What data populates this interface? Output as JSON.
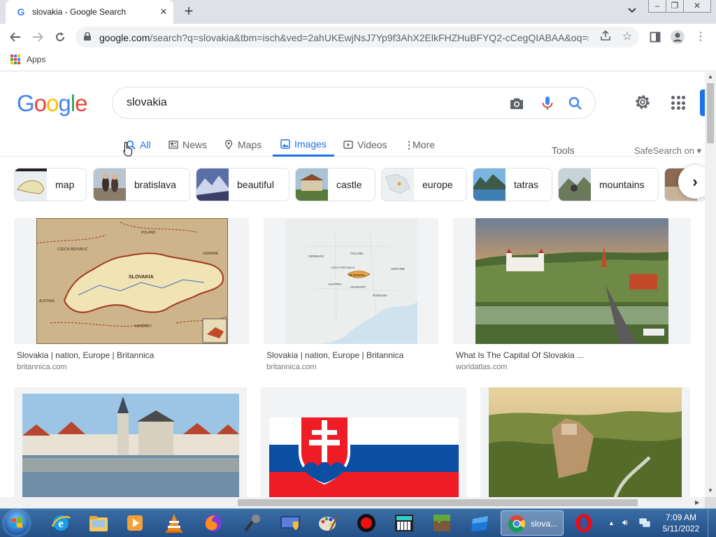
{
  "browser": {
    "tab_title": "slovakia - Google Search",
    "tab_favicon": "G",
    "url_host": "google.com",
    "url_rest": "/search?q=slovakia&tbm=isch&ved=2ahUKEwjNsJ7Yp9f3AhX2ElkFHZHuBFYQ2-cCegQIABAA&oq=sl...",
    "bookmark_apps": "Apps"
  },
  "google": {
    "logo_letters": [
      "G",
      "o",
      "o",
      "g",
      "l",
      "e"
    ],
    "logo_colors": [
      "#4285f4",
      "#ea4335",
      "#fbbc05",
      "#4285f4",
      "#34a853",
      "#ea4335"
    ],
    "query": "slovakia",
    "tabs": [
      {
        "label": "All",
        "icon": "search-icon"
      },
      {
        "label": "News",
        "icon": "news-icon"
      },
      {
        "label": "Maps",
        "icon": "map-pin-icon"
      },
      {
        "label": "Images",
        "icon": "image-icon"
      },
      {
        "label": "Videos",
        "icon": "video-icon"
      },
      {
        "label": "More",
        "icon": "more-vertical-icon"
      }
    ],
    "tools": "Tools",
    "safesearch": "SafeSearch on",
    "chips": [
      {
        "label": "map"
      },
      {
        "label": "bratislava"
      },
      {
        "label": "beautiful"
      },
      {
        "label": "castle"
      },
      {
        "label": "europe"
      },
      {
        "label": "tatras"
      },
      {
        "label": "mountains"
      }
    ],
    "results": [
      {
        "title": "Slovakia | nation, Europe | Britannica",
        "source": "britannica.com"
      },
      {
        "title": "Slovakia | nation, Europe | Britannica",
        "source": "britannica.com"
      },
      {
        "title": "What Is The Capital Of Slovakia ...",
        "source": "worldatlas.com"
      },
      {
        "title": "",
        "source": ""
      },
      {
        "title": "",
        "source": ""
      },
      {
        "title": "",
        "source": ""
      }
    ],
    "map_labels": [
      "SLOVAKIA",
      "AUSTRIA",
      "HUNGARY",
      "CZECH REPUBLIC",
      "POLAND",
      "UKRAINE"
    ],
    "europe_map_labels": [
      "GERMANY",
      "POLAND",
      "CZECH REPUBLIC",
      "SLOVAKIA",
      "UKRAINE",
      "AUSTRIA",
      "HUNGARY",
      "ROMANIA"
    ]
  },
  "taskbar": {
    "chrome_label": "slova...",
    "time": "7:09 AM",
    "date": "5/11/2022"
  }
}
